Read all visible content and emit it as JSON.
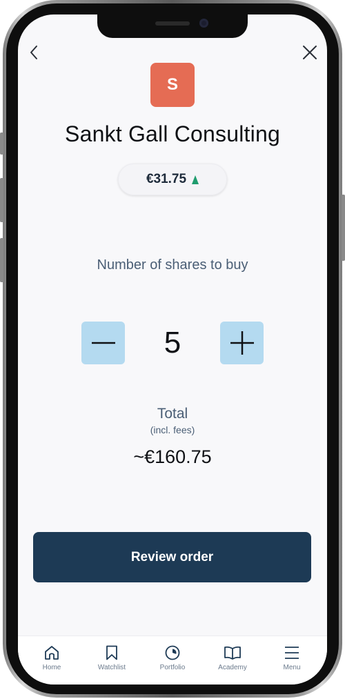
{
  "company": {
    "logo_letter": "S",
    "name": "Sankt Gall Consulting",
    "price": "€31.75",
    "price_trend_icon": "triangle-up-icon",
    "logo_color": "#e56c54",
    "trend_color": "#1f9c6e"
  },
  "order": {
    "shares_label": "Number of shares to buy",
    "quantity": "5",
    "total_label": "Total",
    "total_sub": "(incl. fees)",
    "total_value": "~€160.75",
    "review_label": "Review order"
  },
  "nav": {
    "back_icon": "chevron-left-icon",
    "close_icon": "close-icon"
  },
  "stepper": {
    "minus_icon": "minus-icon",
    "plus_icon": "plus-icon",
    "button_color": "#b4daf0"
  },
  "tabbar": {
    "tabs": [
      {
        "label": "Home",
        "icon": "home-icon"
      },
      {
        "label": "Watchlist",
        "icon": "bookmark-icon"
      },
      {
        "label": "Portfolio",
        "icon": "pie-chart-icon"
      },
      {
        "label": "Academy",
        "icon": "book-icon"
      },
      {
        "label": "Menu",
        "icon": "menu-icon"
      }
    ]
  },
  "theme": {
    "primary_button": "#1d3a55",
    "screen_background": "#f8f8fa"
  }
}
